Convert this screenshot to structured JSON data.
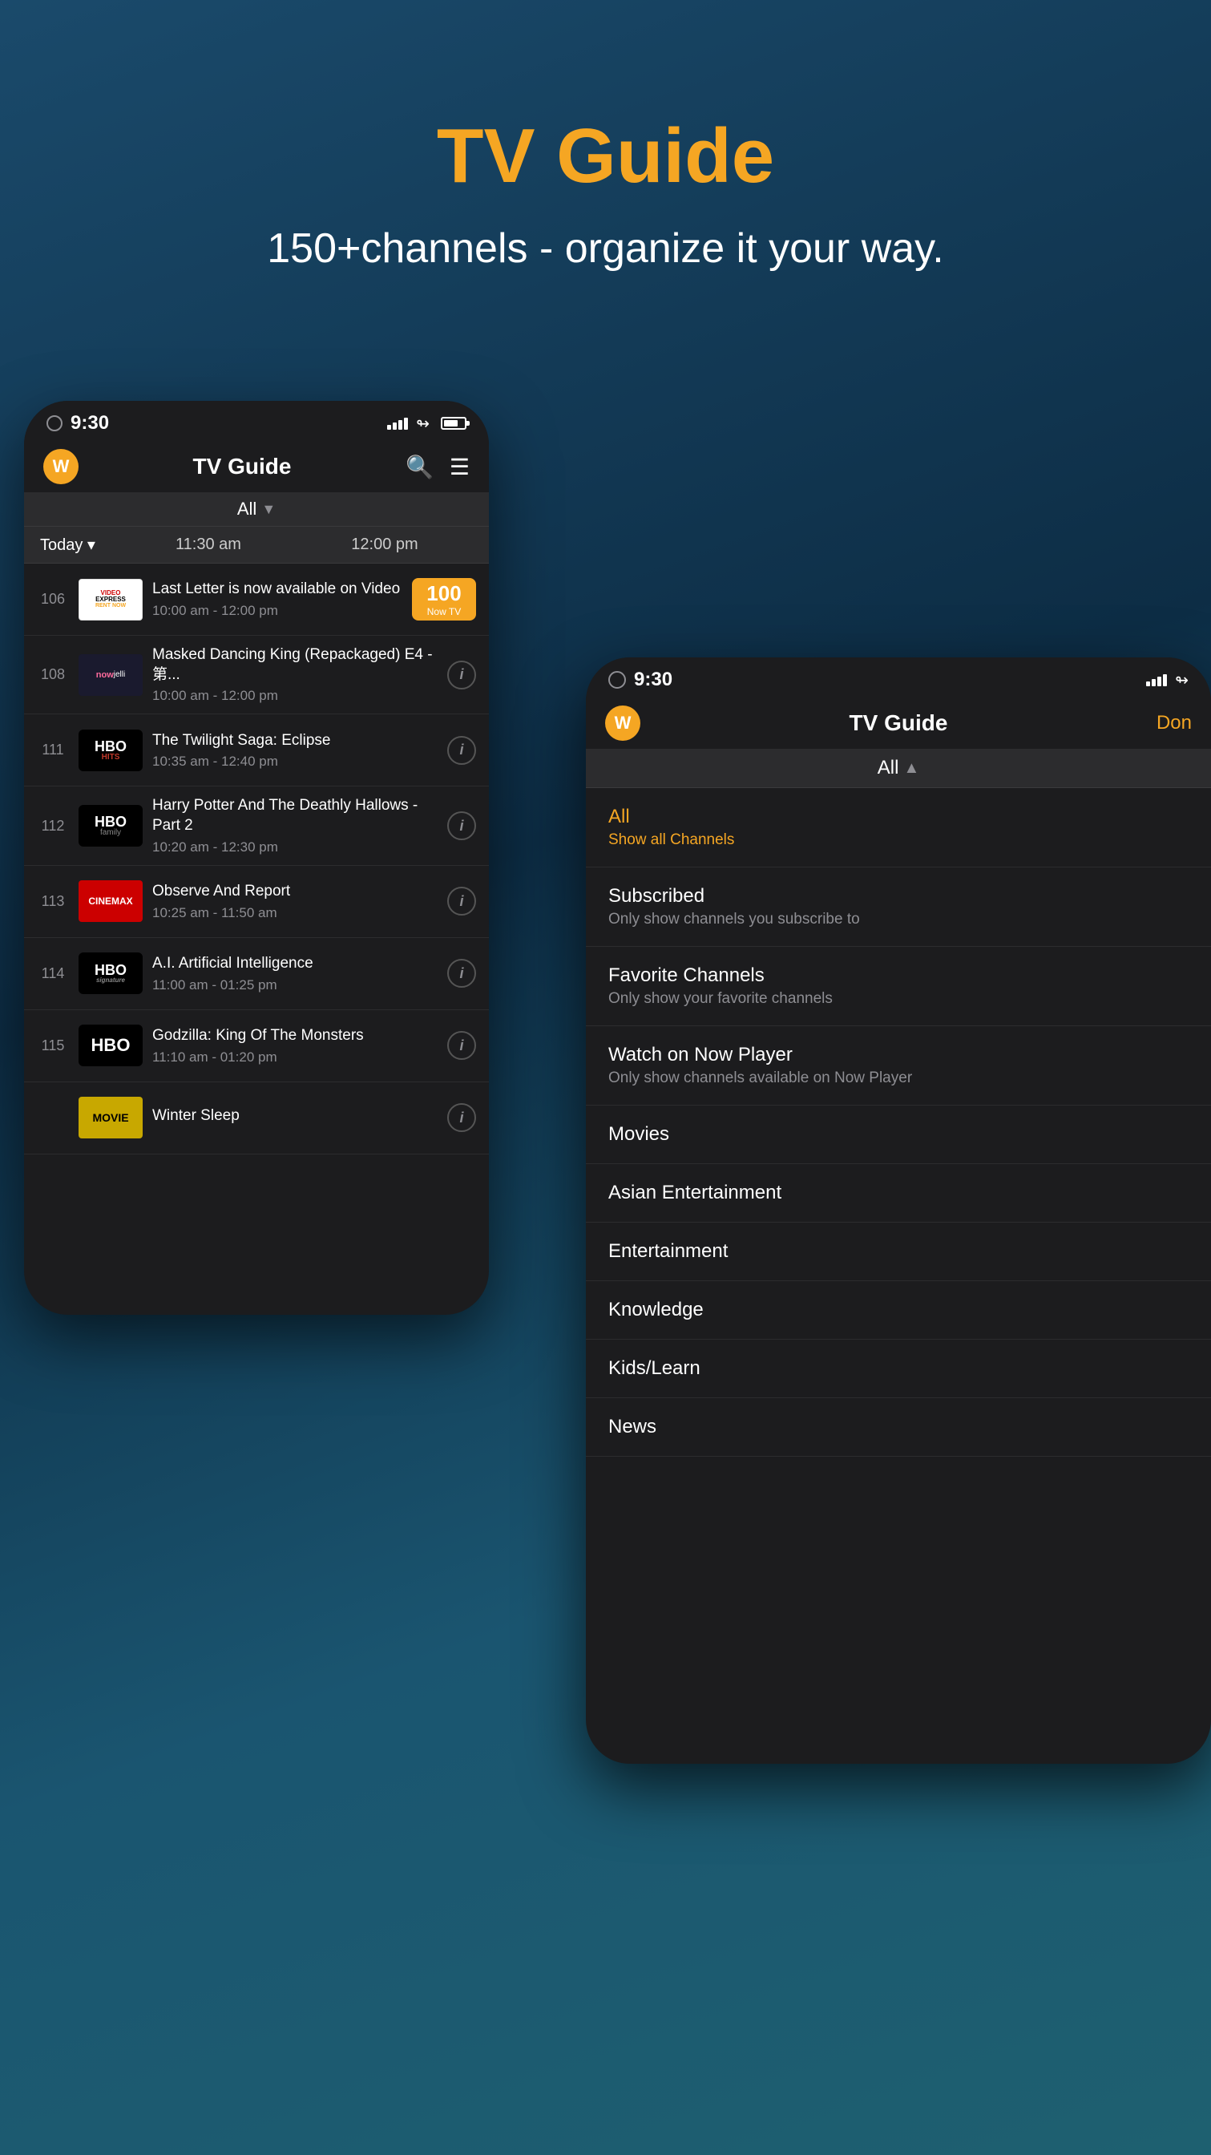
{
  "hero": {
    "title": "TV Guide",
    "subtitle": "150+channels - organize it your way."
  },
  "phone_back": {
    "status": {
      "time": "9:30"
    },
    "nav": {
      "logo_letter": "W",
      "title": "TV Guide"
    },
    "filter": {
      "label": "All",
      "chevron": "▼"
    },
    "time_header": {
      "today": "Today ▾",
      "slot1": "11:30 am",
      "slot2": "12:00 pm"
    },
    "channels": [
      {
        "num": "106",
        "logo_text": "VIDEO\nEXPRESS\nRENT NOW",
        "logo_style": "logo-video-express",
        "title": "Last Letter is now available on Video",
        "time": "10:00 am - 12:00 pm",
        "badge": "now-tv",
        "badge_num": "100",
        "badge_label": "Now TV"
      },
      {
        "num": "108",
        "logo_text": "nowjelli",
        "logo_style": "logo-nowjelli",
        "title": "Masked Dancing King (Repackaged) E4 -第...",
        "time": "10:00 am - 12:00 pm",
        "badge": "info"
      },
      {
        "num": "111",
        "logo_text": "HBO\nHITS",
        "logo_style": "logo-hbo-hits",
        "title": "The Twilight Saga: Eclipse",
        "time": "10:35 am - 12:40 pm",
        "badge": "info"
      },
      {
        "num": "112",
        "logo_text": "HBO\nfamily",
        "logo_style": "logo-hbo-family",
        "title": "Harry Potter And The Deathly Hallows - Part 2",
        "time": "10:20 am - 12:30 pm",
        "badge": "info"
      },
      {
        "num": "113",
        "logo_text": "CINEMAX",
        "logo_style": "logo-cinemax",
        "title": "Observe And Report",
        "time": "10:25 am - 11:50 am",
        "badge": "info"
      },
      {
        "num": "114",
        "logo_text": "HBO\nsignature",
        "logo_style": "logo-hbo-sig",
        "title": "A.I. Artificial Intelligence",
        "time": "11:00 am - 01:25 pm",
        "badge": "info"
      },
      {
        "num": "115",
        "logo_text": "HBO",
        "logo_style": "logo-hbo",
        "title": "Godzilla: King Of The Monsters",
        "time": "11:10 am - 01:20 pm",
        "badge": "info"
      },
      {
        "num": "",
        "logo_text": "MOVIE",
        "logo_style": "logo-movie",
        "title": "Winter Sleep",
        "time": "",
        "badge": "info"
      }
    ]
  },
  "phone_front": {
    "status": {
      "time": "9:30"
    },
    "nav": {
      "logo_letter": "W",
      "title": "TV Guide",
      "done": "Don"
    },
    "filter": {
      "label": "All",
      "chevron": "▲"
    },
    "dropdown_items": [
      {
        "id": "all",
        "title": "All",
        "subtitle": "Show all Channels",
        "active": true,
        "has_subtitle": true
      },
      {
        "id": "subscribed",
        "title": "Subscribed",
        "subtitle": "Only show channels you subscribe to",
        "active": false,
        "has_subtitle": true
      },
      {
        "id": "favorite",
        "title": "Favorite Channels",
        "subtitle": "Only show your favorite channels",
        "active": false,
        "has_subtitle": true
      },
      {
        "id": "nowplayer",
        "title": "Watch on Now Player",
        "subtitle": "Only show channels available on Now Player",
        "active": false,
        "has_subtitle": true
      },
      {
        "id": "movies",
        "title": "Movies",
        "subtitle": "",
        "active": false,
        "has_subtitle": false
      },
      {
        "id": "asian",
        "title": "Asian Entertainment",
        "subtitle": "",
        "active": false,
        "has_subtitle": false
      },
      {
        "id": "entertainment",
        "title": "Entertainment",
        "subtitle": "",
        "active": false,
        "has_subtitle": false
      },
      {
        "id": "knowledge",
        "title": "Knowledge",
        "subtitle": "",
        "active": false,
        "has_subtitle": false
      },
      {
        "id": "kids",
        "title": "Kids/Learn",
        "subtitle": "",
        "active": false,
        "has_subtitle": false
      },
      {
        "id": "news",
        "title": "News",
        "subtitle": "",
        "active": false,
        "has_subtitle": false
      }
    ]
  }
}
